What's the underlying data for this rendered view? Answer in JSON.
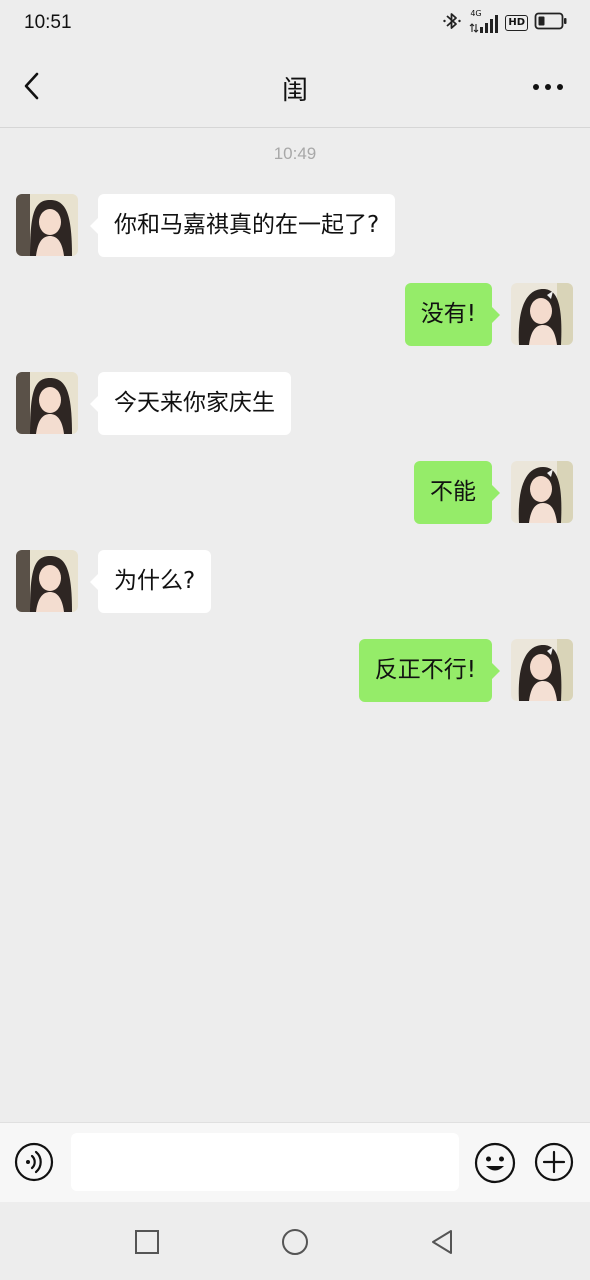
{
  "status_bar": {
    "time": "10:51",
    "network_label": "4G",
    "hd_label": "HD",
    "icons": [
      "bluetooth-icon",
      "signal-icon",
      "hd-icon",
      "battery-icon"
    ]
  },
  "nav": {
    "title": "闺",
    "back_icon": "chevron-left-icon",
    "more_icon": "more-icon"
  },
  "chat": {
    "timestamp": "10:49",
    "messages": [
      {
        "side": "in",
        "text": "你和马嘉祺真的在一起了?"
      },
      {
        "side": "out",
        "text": "没有!"
      },
      {
        "side": "in",
        "text": "今天来你家庆生"
      },
      {
        "side": "out",
        "text": "不能"
      },
      {
        "side": "in",
        "text": "为什么?"
      },
      {
        "side": "out",
        "text": "反正不行!"
      }
    ]
  },
  "input_bar": {
    "placeholder": "",
    "voice_icon": "voice-icon",
    "emoji_icon": "emoji-icon",
    "plus_icon": "plus-icon"
  },
  "system_nav": {
    "icons": [
      "recents-square-icon",
      "home-circle-icon",
      "back-triangle-icon"
    ]
  },
  "colors": {
    "background": "#ededed",
    "bubble_in": "#ffffff",
    "bubble_out": "#95ec69",
    "timestamp": "#a8a8a8"
  }
}
